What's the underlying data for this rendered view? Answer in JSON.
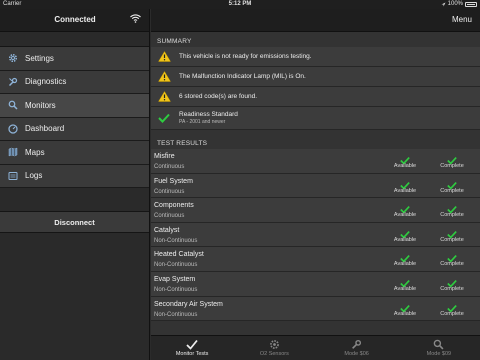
{
  "status_bar": {
    "carrier": "Carrier",
    "time": "5:12 PM",
    "battery": "100%"
  },
  "sidebar": {
    "title": "Connected",
    "items": [
      {
        "label": "Settings",
        "icon": "gear-icon"
      },
      {
        "label": "Diagnostics",
        "icon": "wrench-icon"
      },
      {
        "label": "Monitors",
        "icon": "search-icon"
      },
      {
        "label": "Dashboard",
        "icon": "gauge-icon"
      },
      {
        "label": "Maps",
        "icon": "map-icon"
      },
      {
        "label": "Logs",
        "icon": "log-icon"
      }
    ],
    "active_item": "Monitors",
    "disconnect_label": "Disconnect"
  },
  "header": {
    "menu_label": "Menu"
  },
  "summary": {
    "heading": "SUMMARY",
    "rows": [
      {
        "text": "This vehicle is not ready for emissions testing.",
        "icon": "warning-icon"
      },
      {
        "text": "The Malfunction Indicator Lamp (MIL) is On.",
        "icon": "warning-icon"
      },
      {
        "text": "6 stored code(s) are found.",
        "icon": "warning-icon"
      }
    ],
    "readiness": {
      "title": "Readiness Standard",
      "subtitle": "PA - 2001 and newer",
      "icon": "check-icon"
    }
  },
  "tests": {
    "heading": "TEST RESULTS",
    "rows": [
      {
        "name": "Misfire",
        "type": "Continuous",
        "status1": "Available",
        "status2": "Complete"
      },
      {
        "name": "Fuel System",
        "type": "Continuous",
        "status1": "Available",
        "status2": "Complete"
      },
      {
        "name": "Components",
        "type": "Continuous",
        "status1": "Available",
        "status2": "Complete"
      },
      {
        "name": "Catalyst",
        "type": "Non-Continuous",
        "status1": "Available",
        "status2": "Complete"
      },
      {
        "name": "Heated Catalyst",
        "type": "Non-Continuous",
        "status1": "Available",
        "status2": "Complete"
      },
      {
        "name": "Evap System",
        "type": "Non-Continuous",
        "status1": "Available",
        "status2": "Complete"
      },
      {
        "name": "Secondary Air System",
        "type": "Non-Continuous",
        "status1": "Available",
        "status2": "Complete"
      }
    ]
  },
  "tabbar": {
    "tabs": [
      {
        "label": "Monitor Tests",
        "icon": "check-icon"
      },
      {
        "label": "O2 Sensors",
        "icon": "gear-icon"
      },
      {
        "label": "Mode $06",
        "icon": "wrench-icon"
      },
      {
        "label": "Mode $09",
        "icon": "search-icon"
      }
    ],
    "active_tab": "Monitor Tests"
  },
  "colors": {
    "check": "#2ecc40",
    "warning": "#f0c419",
    "background": "#333333",
    "sidebar": "#2a2a2a"
  }
}
